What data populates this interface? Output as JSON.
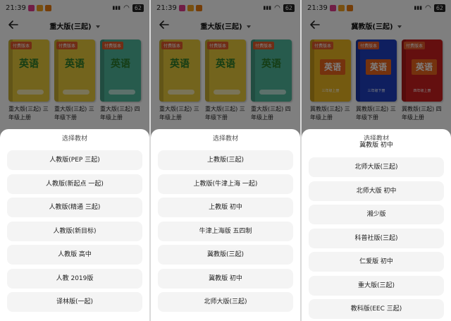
{
  "status": {
    "time": "21:39",
    "battery": "62"
  },
  "panels": [
    {
      "title": "重大版(三起)",
      "books": [
        {
          "name": "重大版(三起) 三年级上册",
          "color": "#e7c93a",
          "tag": "付费版本",
          "word": "英语"
        },
        {
          "name": "重大版(三起) 三年级下册",
          "color": "#e7c93a",
          "tag": "付费版本",
          "word": "英语"
        },
        {
          "name": "重大版(三起) 四年级上册",
          "color": "#4fb79a",
          "tag": "付费版本",
          "word": "英语"
        }
      ],
      "sheet": {
        "title": "选择教材",
        "options": [
          "人教版(PEP 三起)",
          "人教版(新起点 一起)",
          "人教版(精通 三起)",
          "人教版(新目标)",
          "人教版 高中",
          "人教 2019版",
          "译林版(一起)"
        ]
      }
    },
    {
      "title": "重大版(三起)",
      "books": [
        {
          "name": "重大版(三起) 三年级上册",
          "color": "#e7c93a",
          "tag": "付费版本",
          "word": "英语"
        },
        {
          "name": "重大版(三起) 三年级下册",
          "color": "#e7c93a",
          "tag": "付费版本",
          "word": "英语"
        },
        {
          "name": "重大版(三起) 四年级上册",
          "color": "#4fb79a",
          "tag": "付费版本",
          "word": "英语"
        }
      ],
      "sheet": {
        "title": "选择教材",
        "options": [
          "上教版(三起)",
          "上教版(牛津上海 一起)",
          "上教版 初中",
          "牛津上海版 五四制",
          "冀教版(三起)",
          "冀教版 初中",
          "北师大版(三起)"
        ]
      }
    },
    {
      "title": "冀教版(三起)",
      "books": [
        {
          "name": "冀教版(三起) 三年级上册",
          "color": "#e8b420",
          "tag": "付费版本",
          "word": "英语",
          "sub": "三年级上册"
        },
        {
          "name": "冀教版(三起) 三年级下册",
          "color": "#1e3fbf",
          "tag": "付费版本",
          "word": "英语",
          "sub": "三年级下册"
        },
        {
          "name": "冀教版(三起) 四年级上册",
          "color": "#c81e1e",
          "tag": "付费版本",
          "word": "英语",
          "sub": "四年级上册"
        }
      ],
      "sheet": {
        "title": "选择教材",
        "options": [
          "冀教版 初中",
          "北师大版(三起)",
          "北师大版 初中",
          "湘少版",
          "科普社版(三起)",
          "仁爱版 初中",
          "重大版(三起)",
          "教科版(EEC 三起)"
        ]
      }
    }
  ]
}
